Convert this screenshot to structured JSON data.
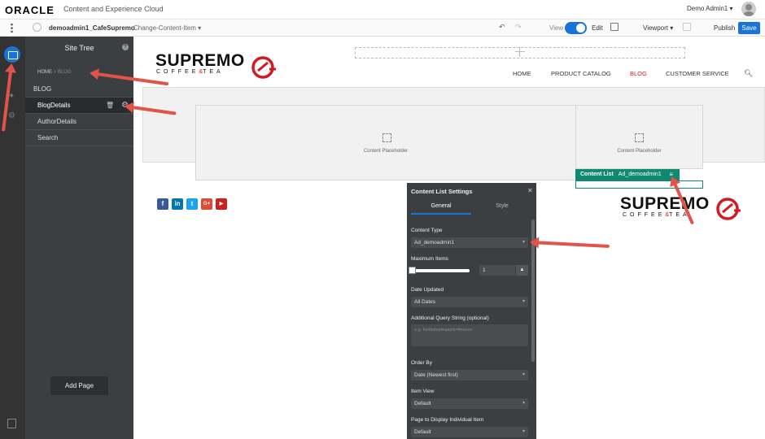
{
  "topbar": {
    "brand": "ORACLE",
    "product": "Content and Experience Cloud",
    "user": "Demo Admin1 ▾"
  },
  "toolbar": {
    "site": "demoadmin1_CafeSupremo",
    "update": "Change-Content-Item ▾",
    "view": "View",
    "edit": "Edit",
    "viewport": "Viewport ▾",
    "publish": "Publish",
    "save": "Save"
  },
  "sidebar": {
    "title": "Site Tree",
    "breadcrumb_home": "HOME",
    "breadcrumb_current": "BLOG",
    "section": "BLOG",
    "items": [
      "BlogDetails",
      "AuthorDetails",
      "Search"
    ],
    "add_page": "Add Page"
  },
  "site": {
    "logo_main": "SUPREMO",
    "logo_coffee": "COFFEE",
    "logo_amp": "&",
    "logo_tea": "TEA",
    "nav": [
      "HOME",
      "PRODUCT CATALOG",
      "BLOG",
      "CUSTOMER SERVICE"
    ],
    "nav_active_color": "#d41a1f",
    "placeholder_label": "Content Placeholder",
    "content_list_label": "Content List",
    "content_list_type": "Ad_demoadmin1",
    "social": [
      "f",
      "in",
      "t",
      "G+",
      "▶"
    ]
  },
  "panel": {
    "title": "Content List Settings",
    "tab_general": "General",
    "tab_style": "Style",
    "content_type_label": "Content Type",
    "content_type_value": "Ad_demoadmin1",
    "max_items_label": "Maximum Items",
    "max_items_value": "1",
    "date_label": "Date Updated",
    "date_value": "All Dates",
    "query_label": "Additional Query String (optional)",
    "query_placeholder": "e.g. fieldsdepteqauls=finance",
    "order_label": "Order By",
    "order_value": "Date (Newest first)",
    "view_label": "Item View",
    "view_value": "Default",
    "page_label": "Page to Display Individual Item",
    "page_value": "Default"
  }
}
